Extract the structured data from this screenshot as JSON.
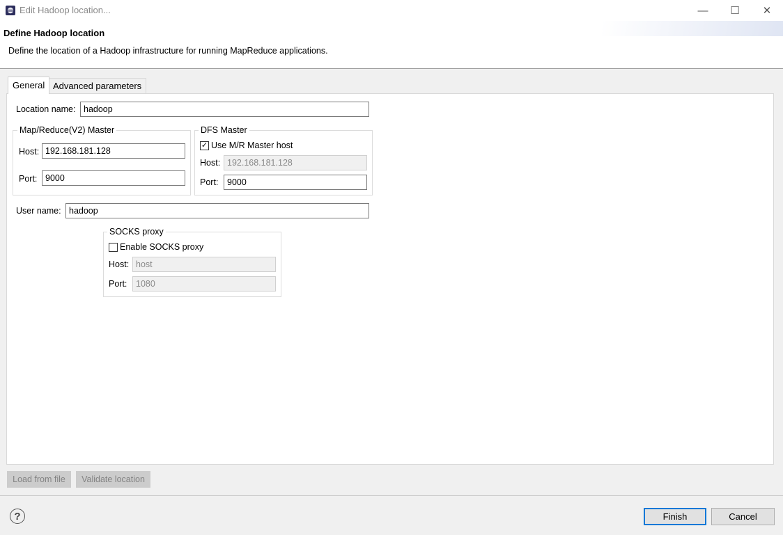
{
  "window": {
    "title": "Edit Hadoop location...",
    "controls": {
      "minimize": "—",
      "maximize": "☐",
      "close": "✕"
    }
  },
  "header": {
    "title": "Define Hadoop location",
    "description": "Define the location of a Hadoop infrastructure for running MapReduce applications."
  },
  "tabs": [
    {
      "label": "General",
      "selected": true
    },
    {
      "label": "Advanced parameters",
      "selected": false
    }
  ],
  "general": {
    "location_name_label": "Location name:",
    "location_name_value": "hadoop",
    "mr_master": {
      "title": "Map/Reduce(V2) Master",
      "host_label": "Host:",
      "host_value": "192.168.181.128",
      "port_label": "Port:",
      "port_value": "9000"
    },
    "dfs_master": {
      "title": "DFS Master",
      "use_mr_label": "Use M/R Master host",
      "use_mr_checked": true,
      "host_label": "Host:",
      "host_value": "192.168.181.128",
      "port_label": "Port:",
      "port_value": "9000"
    },
    "user_name_label": "User name:",
    "user_name_value": "hadoop",
    "socks": {
      "title": "SOCKS proxy",
      "enable_label": "Enable SOCKS proxy",
      "enable_checked": false,
      "host_label": "Host:",
      "host_value": "host",
      "port_label": "Port:",
      "port_value": "1080"
    }
  },
  "actions": {
    "load_from_file": "Load from file",
    "validate_location": "Validate location",
    "finish": "Finish",
    "cancel": "Cancel",
    "help_icon": "?"
  },
  "colors": {
    "dialog_bg": "#f0f0f0",
    "panel_bg": "#ffffff",
    "default_button_border": "#0078d7",
    "disabled_text": "#8a8a8a"
  }
}
